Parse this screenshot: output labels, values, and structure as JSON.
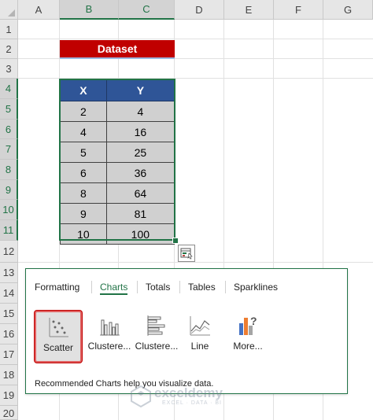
{
  "columns": [
    "A",
    "B",
    "C",
    "D",
    "E",
    "F",
    "G"
  ],
  "rows": [
    "1",
    "2",
    "3",
    "4",
    "5",
    "6",
    "7",
    "8",
    "9",
    "10",
    "11",
    "12",
    "13",
    "14",
    "15",
    "16",
    "17",
    "18",
    "19",
    "20"
  ],
  "dataset": {
    "title": "Dataset",
    "headers": [
      "X",
      "Y"
    ],
    "rows": [
      [
        "2",
        "4"
      ],
      [
        "4",
        "16"
      ],
      [
        "5",
        "25"
      ],
      [
        "6",
        "36"
      ],
      [
        "8",
        "64"
      ],
      [
        "9",
        "81"
      ],
      [
        "10",
        "100"
      ]
    ]
  },
  "quick_analysis": {
    "tabs": [
      {
        "label": "Formatting",
        "active": false
      },
      {
        "label": "Charts",
        "active": true
      },
      {
        "label": "Totals",
        "active": false
      },
      {
        "label": "Tables",
        "active": false
      },
      {
        "label": "Sparklines",
        "active": false
      }
    ],
    "options": [
      {
        "label": "Scatter",
        "icon": "scatter-chart-icon",
        "selected": true
      },
      {
        "label": "Clustere...",
        "icon": "clustered-column-icon",
        "selected": false
      },
      {
        "label": "Clustere...",
        "icon": "clustered-bar-icon",
        "selected": false
      },
      {
        "label": "Line",
        "icon": "line-chart-icon",
        "selected": false
      },
      {
        "label": "More...",
        "icon": "more-charts-icon",
        "selected": false
      }
    ],
    "description": "Recommended Charts help you visualize data."
  },
  "watermark": {
    "name": "exceldemy",
    "tagline": "EXCEL · DATA · BI"
  },
  "colors": {
    "accent": "#217346",
    "header_fill": "#2f5597",
    "title_fill": "#c00000",
    "cell_fill": "#d0d0d0",
    "selection_highlight": "#c00000"
  }
}
